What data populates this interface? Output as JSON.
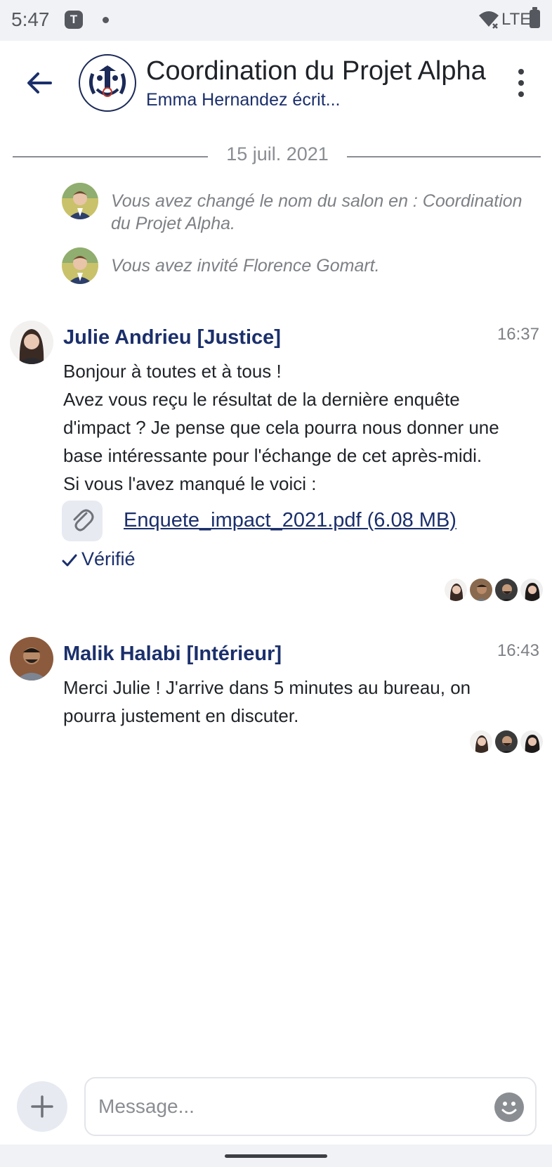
{
  "status_bar": {
    "time": "5:47",
    "app_badge": "T",
    "network": "LTE"
  },
  "header": {
    "back_icon": "arrow-left-icon",
    "title": "Coordination du Projet Alpha",
    "subtitle": "Emma Hernandez écrit...",
    "more_icon": "more-vertical-icon"
  },
  "date_separator": "15 juil. 2021",
  "events": [
    {
      "text": "Vous avez changé le nom du salon en : Coordination du Projet Alpha."
    },
    {
      "text": "Vous avez invité Florence Gomart."
    }
  ],
  "messages": [
    {
      "sender": "Julie Andrieu [Justice]",
      "time": "16:37",
      "lines": [
        "Bonjour à toutes et à tous !",
        "Avez vous reçu le résultat de la dernière enquête d'impact ? Je pense que cela pourra nous donner une base intéressante pour l'échange de cet après-midi.",
        "Si vous l'avez manqué le voici :"
      ],
      "attachment": "Enquete_impact_2021.pdf (6.08 MB)",
      "verified": "Vérifié"
    },
    {
      "sender": "Malik Halabi [Intérieur]",
      "time": "16:43",
      "lines": [
        "Merci Julie ! J'arrive dans 5 minutes au bureau, on pourra justement en discuter."
      ]
    }
  ],
  "composer": {
    "placeholder": "Message...",
    "add_icon": "plus-icon",
    "emoji_icon": "emoji-icon"
  },
  "colors": {
    "accent": "#1b2f6b",
    "muted": "#7d8085",
    "chrome": "#f1f2f6"
  }
}
